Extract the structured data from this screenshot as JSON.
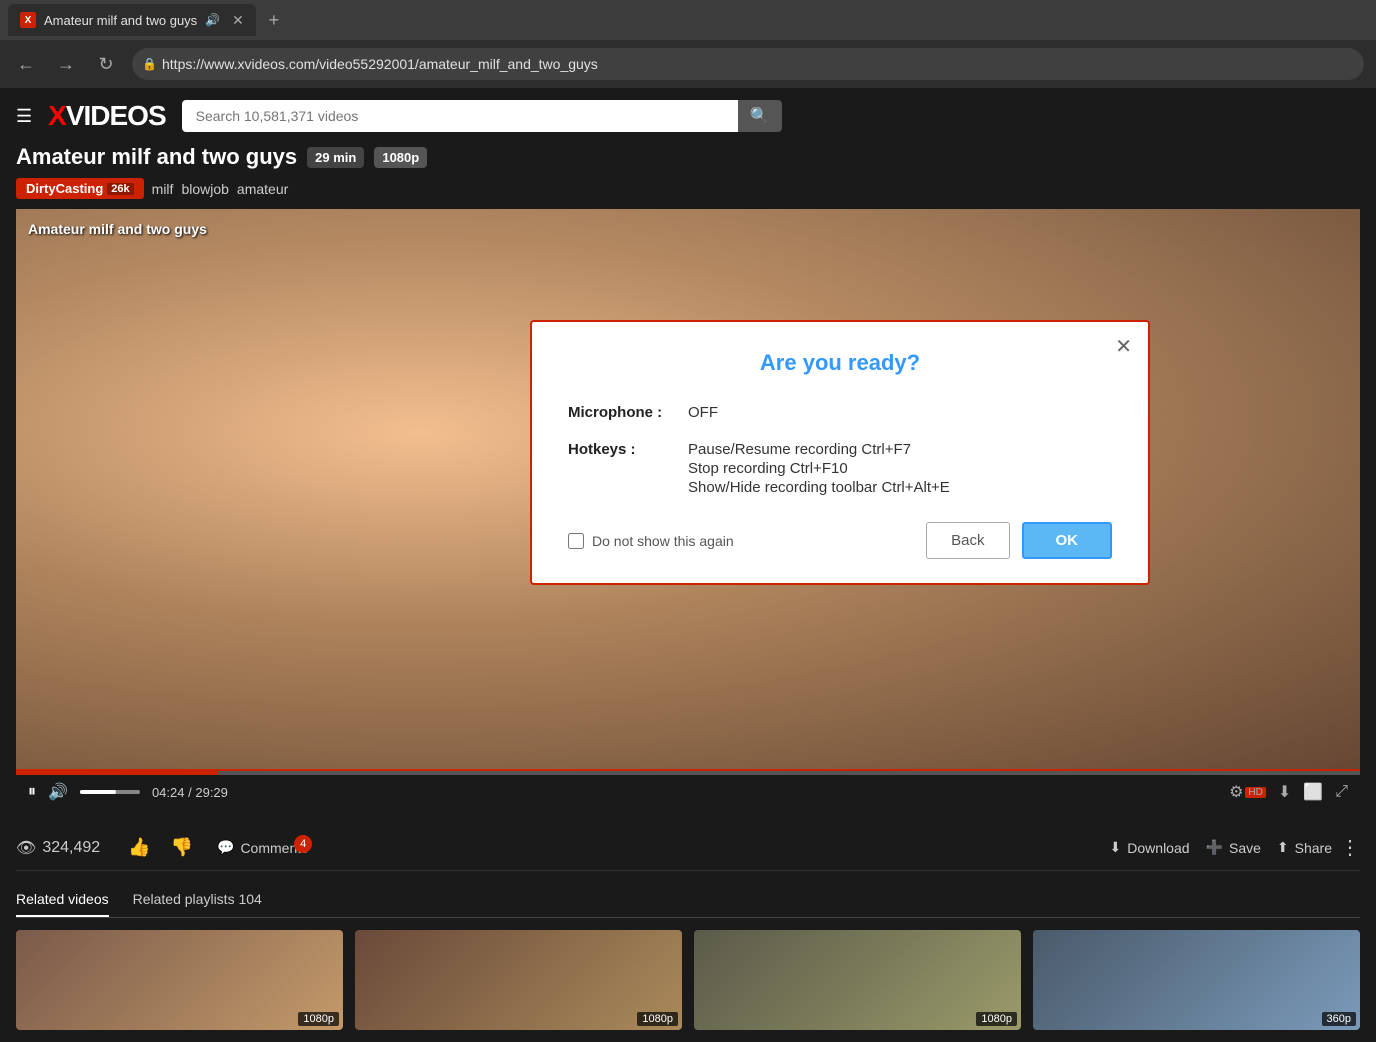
{
  "browser": {
    "tab_favicon": "X",
    "tab_title": "Amateur milf and two guys",
    "tab_mute_icon": "🔊",
    "tab_close_icon": "✕",
    "tab_add_icon": "+",
    "nav_back": "←",
    "nav_forward": "→",
    "nav_refresh": "↻",
    "lock_icon": "🔒",
    "address_url": "https://www.xvideos.com/video55292001/amateur_milf_and_two_guys"
  },
  "site": {
    "hamburger": "☰",
    "logo_x": "X",
    "logo_videos": "VIDEOS",
    "search_placeholder": "Search 10,581,371 videos",
    "search_icon": "🔍"
  },
  "video": {
    "title": "Amateur milf and two guys",
    "duration_badge": "29 min",
    "quality_badge": "1080p",
    "title_overlay": "Amateur milf and two guys",
    "tags": [
      {
        "label": "DirtyCasting",
        "count": "26k",
        "type": "channel"
      },
      {
        "label": "milf",
        "type": "tag"
      },
      {
        "label": "blowjob",
        "type": "tag"
      },
      {
        "label": "amateur",
        "type": "tag"
      }
    ],
    "controls": {
      "play_icon": "⏸",
      "volume_icon": "🔊",
      "time_current": "04:24",
      "time_total": "29:29",
      "time_separator": "/",
      "settings_icon": "⚙",
      "download_icon": "⬇",
      "theater_icon": "⬜",
      "fullscreen_icon": "⤢"
    },
    "views": "324,492",
    "eye_icon": "👁",
    "like_icon": "👍",
    "dislike_icon": "👎",
    "comments_label": "Comments",
    "comments_badge": "4",
    "comment_icon": "💬",
    "download_label": "Download",
    "download_icon": "⬇",
    "save_label": "Save",
    "save_icon": "➕",
    "share_label": "Share",
    "share_icon": "⬆",
    "more_icon": "⋮"
  },
  "related": {
    "tab_active": "Related videos",
    "tab_inactive": "Related playlists 104",
    "thumbnails": [
      {
        "badge": "1080p"
      },
      {
        "badge": "1080p"
      },
      {
        "badge": "1080p"
      },
      {
        "badge": "360p"
      }
    ]
  },
  "dialog": {
    "title": "Are you ready?",
    "close_icon": "✕",
    "microphone_label": "Microphone :",
    "microphone_value": "OFF",
    "hotkeys_label": "Hotkeys :",
    "hotkeys": [
      "Pause/Resume recording Ctrl+F7",
      "Stop recording Ctrl+F10",
      "Show/Hide recording toolbar Ctrl+Alt+E"
    ],
    "do_not_show_label": "Do not show this again",
    "back_label": "Back",
    "ok_label": "OK"
  }
}
